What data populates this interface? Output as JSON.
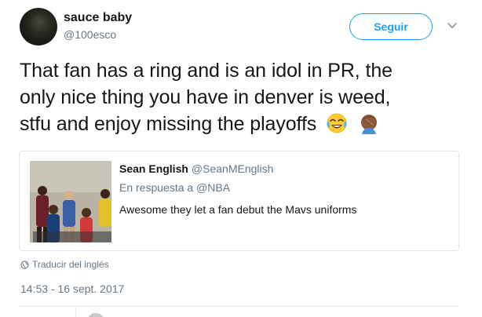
{
  "tweet": {
    "author": {
      "name": "sauce baby",
      "handle": "@100esco"
    },
    "follow_label": "Seguir",
    "text_line1": "That fan has a ring and is an idol in PR, the",
    "text_line2": "only nice thing you have in denver is weed,",
    "text_line3": "stfu and enjoy missing the playoffs",
    "emojis": [
      "face-with-tears-of-joy-icon",
      "man-facepalming-icon"
    ],
    "translate_label": "Traducir del inglés",
    "timestamp": "14:53 - 16 sept. 2017"
  },
  "quote": {
    "author_name": "Sean English",
    "author_handle": "@SeanMEnglish",
    "reply_to": "En respuesta a @NBA",
    "text": "Awesome they let a fan debut the Mavs uniforms"
  },
  "colors": {
    "accent": "#1da1f2",
    "muted": "#657786",
    "text": "#14171a",
    "border": "#e1e8ed"
  }
}
